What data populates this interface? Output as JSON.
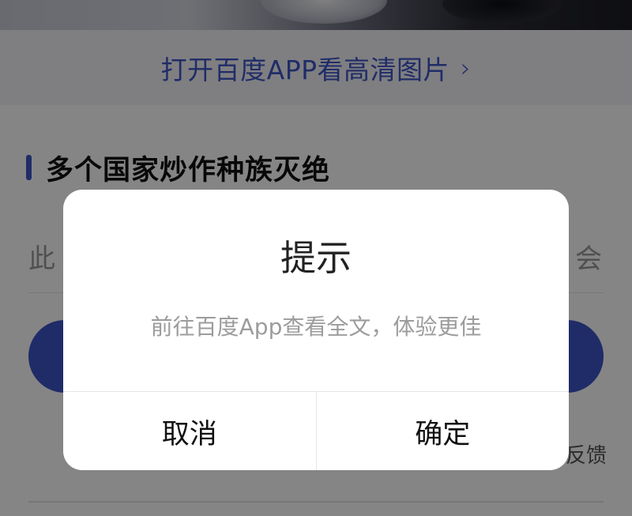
{
  "open_app": {
    "label": "打开百度APP看高清图片",
    "chevron": "›"
  },
  "article": {
    "title": "多个国家炒作种族灭绝",
    "line_start": "此",
    "line_end": "会",
    "feedback_label": "反馈"
  },
  "dialog": {
    "title": "提示",
    "message": "前往百度App查看全文，体验更佳",
    "cancel_label": "取消",
    "confirm_label": "确定"
  },
  "colors": {
    "accent": "#3e55c8",
    "overlay": "rgba(0,0,0,0.48)"
  }
}
